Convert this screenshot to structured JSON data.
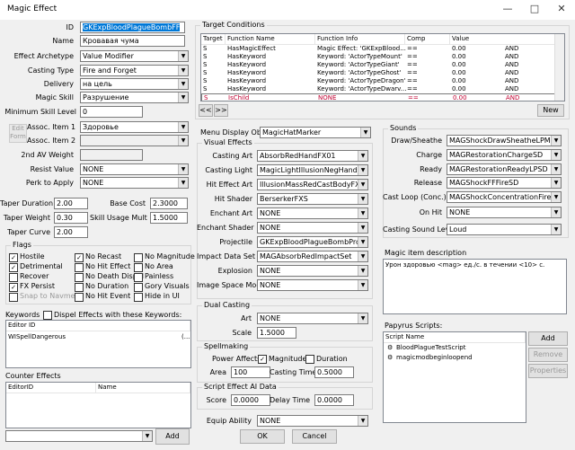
{
  "window": {
    "title": "Magic Effect",
    "minimize": "—",
    "maximize": "□",
    "close": "✕"
  },
  "left": {
    "id_label": "ID",
    "id_value": "GKExpBloodPlagueBombFF",
    "name_label": "Name",
    "name_value": "Кровавая чума",
    "archetype_label": "Effect Archetype",
    "archetype_value": "Value Modifier",
    "casting_type_label": "Casting Type",
    "casting_type_value": "Fire and Forget",
    "delivery_label": "Delivery",
    "delivery_value": "на цель",
    "magic_skill_label": "Magic Skill",
    "magic_skill_value": "Разрушение",
    "min_skill_label": "Minimum Skill Level",
    "min_skill_value": "0",
    "edit_form_label": "Edit Form",
    "assoc1_label": "Assoc. Item 1",
    "assoc1_value": "Здоровье",
    "assoc2_label": "Assoc. Item 2",
    "assoc2_value": "",
    "av2_label": "2nd AV Weight",
    "av2_value": "",
    "resist_label": "Resist Value",
    "resist_value": "NONE",
    "perk_label": "Perk to Apply",
    "perk_value": "NONE",
    "taper_duration_label": "Taper Duration",
    "taper_duration_value": "2.00",
    "base_cost_label": "Base Cost",
    "base_cost_value": "2.3000",
    "taper_weight_label": "Taper Weight",
    "taper_weight_value": "0.30",
    "skill_usage_label": "Skill Usage Mult",
    "skill_usage_value": "1.5000",
    "taper_curve_label": "Taper Curve",
    "taper_curve_value": "2.00"
  },
  "flags": {
    "title": "Flags",
    "items": [
      {
        "label": "Hostile",
        "checked": true
      },
      {
        "label": "No Recast",
        "checked": true
      },
      {
        "label": "No Magnitude",
        "checked": false
      },
      {
        "label": "Detrimental",
        "checked": true
      },
      {
        "label": "No Hit Effect",
        "checked": false
      },
      {
        "label": "No Area",
        "checked": false
      },
      {
        "label": "Recover",
        "checked": false
      },
      {
        "label": "No Death Dispel",
        "checked": false
      },
      {
        "label": "Painless",
        "checked": false
      },
      {
        "label": "FX Persist",
        "checked": true
      },
      {
        "label": "No Duration",
        "checked": false
      },
      {
        "label": "Gory Visuals",
        "checked": false
      },
      {
        "label": "Snap to Navmesh",
        "checked": false
      },
      {
        "label": "No Hit Event",
        "checked": false
      },
      {
        "label": "Hide in UI",
        "checked": false
      }
    ]
  },
  "keywords": {
    "label": "Keywords",
    "dispel_label": "Dispel Effects with these Keywords:",
    "col_editor_id": "Editor ID",
    "rows": [
      {
        "editor_id": "WISpellDangerous",
        "extra": "(..."
      }
    ]
  },
  "counter": {
    "label": "Counter Effects",
    "col_editor_id": "EditorID",
    "col_name": "Name",
    "add_label": "Add"
  },
  "target_conditions": {
    "title": "Target Conditions",
    "columns": [
      "Target",
      "Function Name",
      "Function Info",
      "Comp",
      "Value"
    ],
    "rows": [
      {
        "target": "S",
        "fn": "HasMagicEffect",
        "info": "Magic Effect: 'GKExpBlood...",
        "comp": "==",
        "value": "0.00",
        "op": "AND",
        "selected": false
      },
      {
        "target": "S",
        "fn": "HasKeyword",
        "info": "Keyword: 'ActorTypeMount'",
        "comp": "==",
        "value": "0.00",
        "op": "AND",
        "selected": false
      },
      {
        "target": "S",
        "fn": "HasKeyword",
        "info": "Keyword: 'ActorTypeGiant'",
        "comp": "==",
        "value": "0.00",
        "op": "AND",
        "selected": false
      },
      {
        "target": "S",
        "fn": "HasKeyword",
        "info": "Keyword: 'ActorTypeGhost'",
        "comp": "==",
        "value": "0.00",
        "op": "AND",
        "selected": false
      },
      {
        "target": "S",
        "fn": "HasKeyword",
        "info": "Keyword: 'ActorTypeDragon'",
        "comp": "==",
        "value": "0.00",
        "op": "AND",
        "selected": false
      },
      {
        "target": "S",
        "fn": "HasKeyword",
        "info": "Keyword: 'ActorTypeDwarv...",
        "comp": "==",
        "value": "0.00",
        "op": "AND",
        "selected": false
      },
      {
        "target": "S",
        "fn": "IsChild",
        "info": "NONE",
        "comp": "==",
        "value": "0.00",
        "op": "AND",
        "selected": true
      }
    ],
    "prev_label": "<<",
    "next_label": ">>",
    "new_label": "New"
  },
  "menu_display": {
    "label": "Menu Display Object",
    "value": "MagicHatMarker"
  },
  "visual_effects": {
    "title": "Visual Effects",
    "items": [
      {
        "label": "Casting Art",
        "value": "AbsorbRedHandFX01"
      },
      {
        "label": "Casting Light",
        "value": "MagicLightIllusionNegHand01"
      },
      {
        "label": "Hit Effect Art",
        "value": "IllusionMassRedCastBodyFX"
      },
      {
        "label": "Hit Shader",
        "value": "BerserkerFXS"
      },
      {
        "label": "Enchant Art",
        "value": "NONE"
      },
      {
        "label": "Enchant Shader",
        "value": "NONE"
      },
      {
        "label": "Projectile",
        "value": "GKExpBloodPlagueBombProjectile"
      },
      {
        "label": "Impact Data Set",
        "value": "MAGAbsorbRedImpactSet"
      },
      {
        "label": "Explosion",
        "value": "NONE"
      },
      {
        "label": "Image Space Mod",
        "value": "NONE"
      }
    ]
  },
  "dual_casting": {
    "title": "Dual Casting",
    "art_label": "Art",
    "art_value": "NONE",
    "scale_label": "Scale",
    "scale_value": "1.5000"
  },
  "spellmaking": {
    "title": "Spellmaking",
    "power_label": "Power Affects",
    "magnitude_label": "Magnitude",
    "duration_label": "Duration",
    "area_label": "Area",
    "area_value": "100",
    "casting_time_label": "Casting Time",
    "casting_time_value": "0.5000"
  },
  "ai_data": {
    "title": "Script Effect AI Data",
    "score_label": "Score",
    "score_value": "0.0000",
    "delay_label": "Delay Time",
    "delay_value": "0.0000"
  },
  "equip": {
    "label": "Equip Ability",
    "value": "NONE"
  },
  "footer": {
    "ok_label": "OK",
    "cancel_label": "Cancel"
  },
  "sounds": {
    "title": "Sounds",
    "items": [
      {
        "label": "Draw/Sheathe",
        "value": "MAGShockDrawSheatheLPMSD"
      },
      {
        "label": "Charge",
        "value": "MAGRestorationChargeSD"
      },
      {
        "label": "Ready",
        "value": "MAGRestorationReadyLPSD"
      },
      {
        "label": "Release",
        "value": "MAGShockFFFireSD"
      },
      {
        "label": "Cast Loop (Conc.)",
        "value": "MAGShockConcentrationFireLPMS"
      },
      {
        "label": "On Hit",
        "value": "NONE"
      }
    ],
    "level_label": "Casting Sound Level",
    "level_value": "Loud"
  },
  "description": {
    "label": "Magic item description",
    "text": "Урон здоровью <mag> ед./с. в течении <10> с."
  },
  "papyrus": {
    "label": "Papyrus Scripts:",
    "col_name": "Script Name",
    "scripts": [
      "BloodPlagueTestScript",
      "magicmodbeginloopend"
    ],
    "add_label": "Add",
    "remove_label": "Remove",
    "properties_label": "Properties"
  }
}
